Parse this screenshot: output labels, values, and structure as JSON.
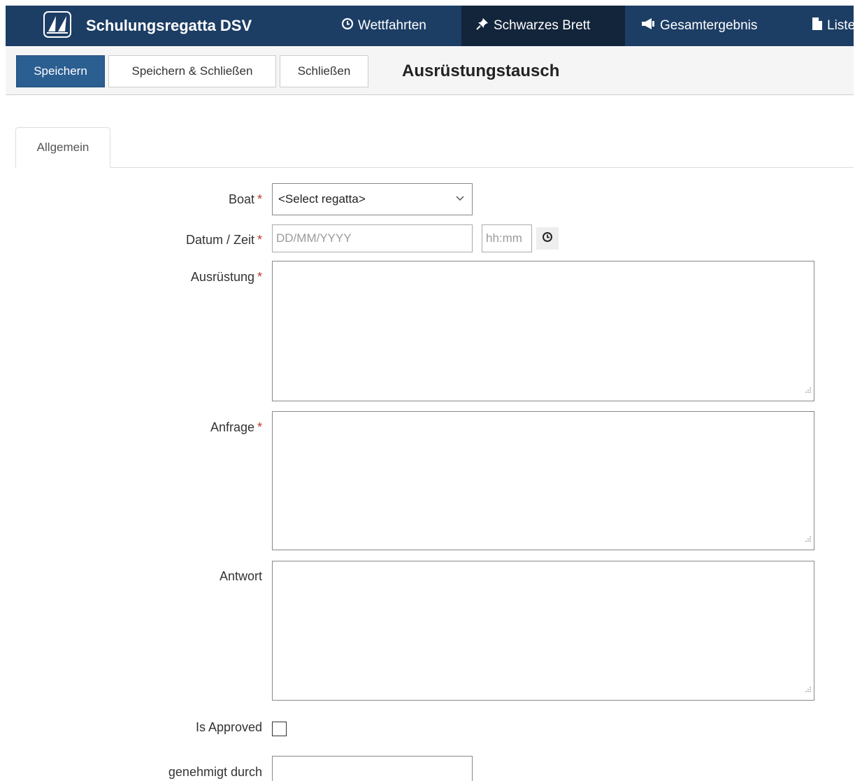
{
  "navbar": {
    "brand_title": "Schulungsregatta DSV",
    "items": [
      {
        "label": "Wettfahrten",
        "icon": "clock-icon",
        "active": false
      },
      {
        "label": "Schwarzes Brett",
        "icon": "pin-icon",
        "active": true
      },
      {
        "label": "Gesamtergebnis",
        "icon": "megaphone-icon",
        "active": false
      },
      {
        "label": "Listen",
        "icon": "file-icon",
        "active": false
      }
    ]
  },
  "toolbar": {
    "save_label": "Speichern",
    "save_close_label": "Speichern & Schließen",
    "close_label": "Schließen",
    "page_title": "Ausrüstungstausch"
  },
  "tabs": [
    {
      "label": "Allgemein",
      "active": true
    }
  ],
  "form": {
    "boat": {
      "label": "Boat",
      "required": "*",
      "value": "<Select regatta>"
    },
    "datetime": {
      "label": "Datum / Zeit",
      "required": "*",
      "date_placeholder": "DD/MM/YYYY",
      "time_placeholder": "hh:mm"
    },
    "equipment": {
      "label": "Ausrüstung",
      "required": "*",
      "value": ""
    },
    "request": {
      "label": "Anfrage",
      "required": "*",
      "value": ""
    },
    "answer": {
      "label": "Antwort",
      "value": ""
    },
    "approved": {
      "label": "Is Approved",
      "checked": false
    },
    "approved_by": {
      "label": "genehmigt durch",
      "value": ""
    }
  },
  "colors": {
    "navbar_bg": "#1c3d64",
    "navbar_active_bg": "#13253b",
    "primary_button": "#2b5e91",
    "required_mark": "#c0392b"
  }
}
